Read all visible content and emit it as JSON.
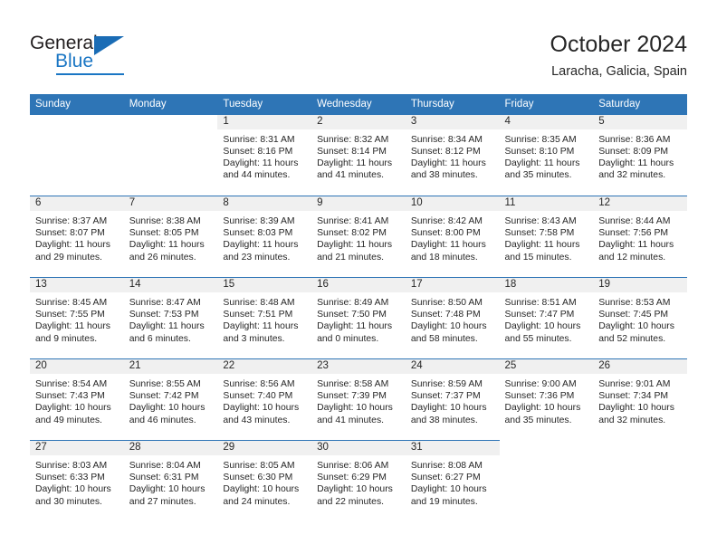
{
  "brand": {
    "name_dark": "General",
    "name_blue": "Blue",
    "accent_color": "#2e75b6",
    "logo_blue": "#1a76c4"
  },
  "header": {
    "title": "October 2024",
    "subtitle": "Laracha, Galicia, Spain"
  },
  "calendar": {
    "weekday_headers": [
      "Sunday",
      "Monday",
      "Tuesday",
      "Wednesday",
      "Thursday",
      "Friday",
      "Saturday"
    ],
    "labels": {
      "sunrise_prefix": "Sunrise:",
      "sunset_prefix": "Sunset:",
      "daylight_prefix": "Daylight:"
    },
    "weeks": [
      [
        {
          "day": "",
          "blank": true
        },
        {
          "day": "",
          "blank": true
        },
        {
          "day": "1",
          "sunrise": "Sunrise: 8:31 AM",
          "sunset": "Sunset: 8:16 PM",
          "daylight": "Daylight: 11 hours and 44 minutes."
        },
        {
          "day": "2",
          "sunrise": "Sunrise: 8:32 AM",
          "sunset": "Sunset: 8:14 PM",
          "daylight": "Daylight: 11 hours and 41 minutes."
        },
        {
          "day": "3",
          "sunrise": "Sunrise: 8:34 AM",
          "sunset": "Sunset: 8:12 PM",
          "daylight": "Daylight: 11 hours and 38 minutes."
        },
        {
          "day": "4",
          "sunrise": "Sunrise: 8:35 AM",
          "sunset": "Sunset: 8:10 PM",
          "daylight": "Daylight: 11 hours and 35 minutes."
        },
        {
          "day": "5",
          "sunrise": "Sunrise: 8:36 AM",
          "sunset": "Sunset: 8:09 PM",
          "daylight": "Daylight: 11 hours and 32 minutes."
        }
      ],
      [
        {
          "day": "6",
          "sunrise": "Sunrise: 8:37 AM",
          "sunset": "Sunset: 8:07 PM",
          "daylight": "Daylight: 11 hours and 29 minutes."
        },
        {
          "day": "7",
          "sunrise": "Sunrise: 8:38 AM",
          "sunset": "Sunset: 8:05 PM",
          "daylight": "Daylight: 11 hours and 26 minutes."
        },
        {
          "day": "8",
          "sunrise": "Sunrise: 8:39 AM",
          "sunset": "Sunset: 8:03 PM",
          "daylight": "Daylight: 11 hours and 23 minutes."
        },
        {
          "day": "9",
          "sunrise": "Sunrise: 8:41 AM",
          "sunset": "Sunset: 8:02 PM",
          "daylight": "Daylight: 11 hours and 21 minutes."
        },
        {
          "day": "10",
          "sunrise": "Sunrise: 8:42 AM",
          "sunset": "Sunset: 8:00 PM",
          "daylight": "Daylight: 11 hours and 18 minutes."
        },
        {
          "day": "11",
          "sunrise": "Sunrise: 8:43 AM",
          "sunset": "Sunset: 7:58 PM",
          "daylight": "Daylight: 11 hours and 15 minutes."
        },
        {
          "day": "12",
          "sunrise": "Sunrise: 8:44 AM",
          "sunset": "Sunset: 7:56 PM",
          "daylight": "Daylight: 11 hours and 12 minutes."
        }
      ],
      [
        {
          "day": "13",
          "sunrise": "Sunrise: 8:45 AM",
          "sunset": "Sunset: 7:55 PM",
          "daylight": "Daylight: 11 hours and 9 minutes."
        },
        {
          "day": "14",
          "sunrise": "Sunrise: 8:47 AM",
          "sunset": "Sunset: 7:53 PM",
          "daylight": "Daylight: 11 hours and 6 minutes."
        },
        {
          "day": "15",
          "sunrise": "Sunrise: 8:48 AM",
          "sunset": "Sunset: 7:51 PM",
          "daylight": "Daylight: 11 hours and 3 minutes."
        },
        {
          "day": "16",
          "sunrise": "Sunrise: 8:49 AM",
          "sunset": "Sunset: 7:50 PM",
          "daylight": "Daylight: 11 hours and 0 minutes."
        },
        {
          "day": "17",
          "sunrise": "Sunrise: 8:50 AM",
          "sunset": "Sunset: 7:48 PM",
          "daylight": "Daylight: 10 hours and 58 minutes."
        },
        {
          "day": "18",
          "sunrise": "Sunrise: 8:51 AM",
          "sunset": "Sunset: 7:47 PM",
          "daylight": "Daylight: 10 hours and 55 minutes."
        },
        {
          "day": "19",
          "sunrise": "Sunrise: 8:53 AM",
          "sunset": "Sunset: 7:45 PM",
          "daylight": "Daylight: 10 hours and 52 minutes."
        }
      ],
      [
        {
          "day": "20",
          "sunrise": "Sunrise: 8:54 AM",
          "sunset": "Sunset: 7:43 PM",
          "daylight": "Daylight: 10 hours and 49 minutes."
        },
        {
          "day": "21",
          "sunrise": "Sunrise: 8:55 AM",
          "sunset": "Sunset: 7:42 PM",
          "daylight": "Daylight: 10 hours and 46 minutes."
        },
        {
          "day": "22",
          "sunrise": "Sunrise: 8:56 AM",
          "sunset": "Sunset: 7:40 PM",
          "daylight": "Daylight: 10 hours and 43 minutes."
        },
        {
          "day": "23",
          "sunrise": "Sunrise: 8:58 AM",
          "sunset": "Sunset: 7:39 PM",
          "daylight": "Daylight: 10 hours and 41 minutes."
        },
        {
          "day": "24",
          "sunrise": "Sunrise: 8:59 AM",
          "sunset": "Sunset: 7:37 PM",
          "daylight": "Daylight: 10 hours and 38 minutes."
        },
        {
          "day": "25",
          "sunrise": "Sunrise: 9:00 AM",
          "sunset": "Sunset: 7:36 PM",
          "daylight": "Daylight: 10 hours and 35 minutes."
        },
        {
          "day": "26",
          "sunrise": "Sunrise: 9:01 AM",
          "sunset": "Sunset: 7:34 PM",
          "daylight": "Daylight: 10 hours and 32 minutes."
        }
      ],
      [
        {
          "day": "27",
          "sunrise": "Sunrise: 8:03 AM",
          "sunset": "Sunset: 6:33 PM",
          "daylight": "Daylight: 10 hours and 30 minutes."
        },
        {
          "day": "28",
          "sunrise": "Sunrise: 8:04 AM",
          "sunset": "Sunset: 6:31 PM",
          "daylight": "Daylight: 10 hours and 27 minutes."
        },
        {
          "day": "29",
          "sunrise": "Sunrise: 8:05 AM",
          "sunset": "Sunset: 6:30 PM",
          "daylight": "Daylight: 10 hours and 24 minutes."
        },
        {
          "day": "30",
          "sunrise": "Sunrise: 8:06 AM",
          "sunset": "Sunset: 6:29 PM",
          "daylight": "Daylight: 10 hours and 22 minutes."
        },
        {
          "day": "31",
          "sunrise": "Sunrise: 8:08 AM",
          "sunset": "Sunset: 6:27 PM",
          "daylight": "Daylight: 10 hours and 19 minutes."
        },
        {
          "day": "",
          "blank": true
        },
        {
          "day": "",
          "blank": true
        }
      ]
    ]
  }
}
